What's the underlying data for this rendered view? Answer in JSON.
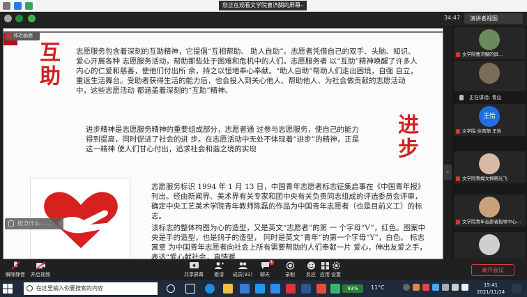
{
  "system": {
    "share_banner": "您正在观看文学院曹济醐的屏幕",
    "more_glyph": "⋯"
  },
  "zoom": {
    "timer": "34:47",
    "view_button": "演讲者视图"
  },
  "slide": {
    "title_mutual": "互助",
    "title_progress": "进步",
    "para1": "志愿服务包含着深刻的互助精神，它提倡“互相帮助、 助人自助”。志愿者凭借自己的双手、头脑、知识、爱心开展各种 志愿服务活动，帮助那些处于困难和危机中的人们。志愿服务者 以“互助”精神唤醒了许多人内心的仁爱和慈善，使他们付出所 余，持之以恒地奉心奉献。“助人自助”帮助人们走出困境，自强 自立，重返生活舞台。受助者获得生活的能力后，也会投入到关心他人、帮助他人、为社会做贡献的志愿活动中，这些志愿活动 都涵盖着深刻的“互助”精神。",
    "para2": "进步精神是志愿服务精神的重要组成部分，志愿者通 过参与志愿服务，使自己的能力得到提高，同时促进了社会的进 步。在志愿活动中无处不体现着“进步”的精神，正是这一精神 使人们甘心付出，追求社会和谐之境的实现",
    "para3": "志愿服务标识 1994 年 1 月 13 日，中国青年志愿者标志征集启事在《中国青年报》刊出。经由新闻界、美术界有关专家和团中央有关负责同志组成的评选委员会评审，确定中央工艺美术学院青年教师陈磊的作品为中国青年志愿者（也是目前义工）的标志。",
    "para4": "该标志的整体构图为心的造型，又是英文“志愿者”的第 一 个字母“V”，红色。图案中央是手的造型，也是鸽子的造型， 同时是英文“青年”的第一个字母“Y”，白色。 标志寓意 为中国青年志愿者向社会上所有需要帮助的人们奉献一片 爱心，伸出友爱之手，表达“爱心献社会，真情暖"
  },
  "stage": {
    "presenter_label": "邻近画面",
    "mute_chip": "按点什么……",
    "collapse_glyph": "›"
  },
  "sidebar": {
    "tiles": [
      {
        "name": "文学院曹济醐的屏…",
        "muted": true
      },
      {
        "name": "",
        "muted": false
      },
      {
        "name": "文学院 体育部 王怡",
        "muted": true,
        "avatar_text": "王怡"
      },
      {
        "name": "文学院青媒文棉韩光飞",
        "muted": true
      },
      {
        "name": "文学院青年志愿者指导中心…",
        "muted": true
      },
      {
        "name": "",
        "muted": false
      }
    ],
    "speaking": "正在讲话: 青山"
  },
  "controls": {
    "mute": "解除静音",
    "video": "开启视频",
    "share": "共享屏幕",
    "invite": "邀请",
    "participants": "成员(92)",
    "chat": "聊天",
    "record": "录制",
    "reactions": "反应",
    "apps": "应用",
    "settings": "设置",
    "leave": "离开会议",
    "chat_badge": "1"
  },
  "taskbar": {
    "search_placeholder": "在这里输入你要搜索的内容",
    "battery": "93%",
    "weather": "11°C",
    "time": "15:41",
    "date": "2021/11/14"
  },
  "colors": {
    "accent_red": "#d02121",
    "logo_red": "#d6211f",
    "zoom_dark": "#222222",
    "leave_red": "#e05252",
    "taskbar": "#1f2b3b"
  }
}
